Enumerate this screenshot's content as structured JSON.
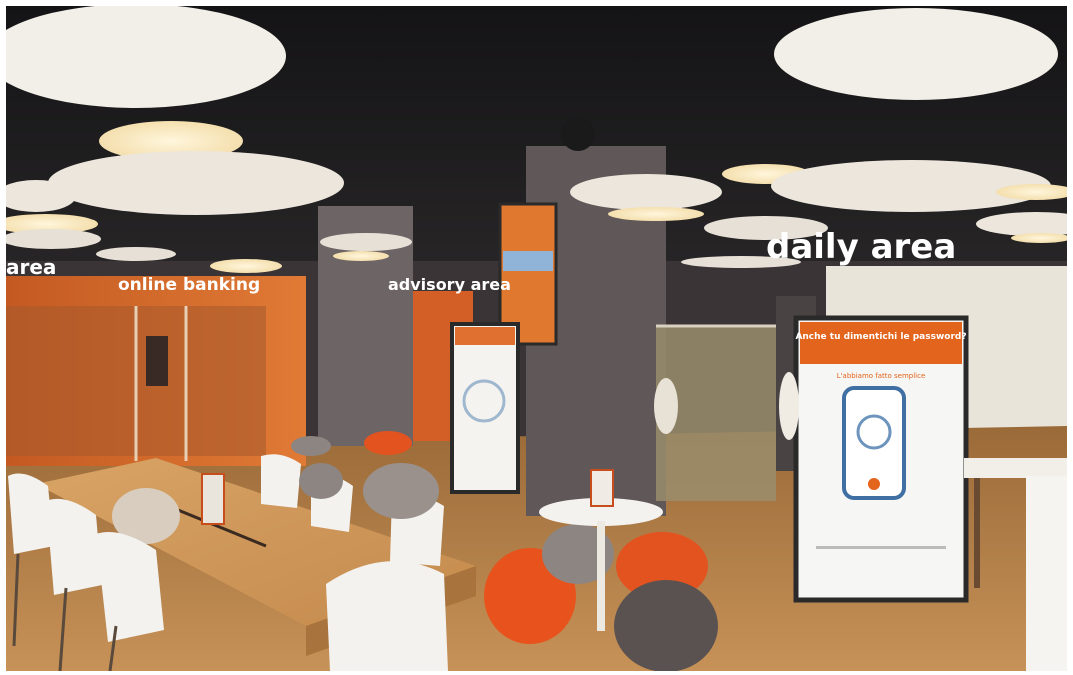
{
  "signs": {
    "area_left": "area",
    "online_banking": "online banking",
    "advisory_area": "advisory area",
    "daily_area": "daily area"
  },
  "poster": {
    "headline": "Anche tu dimentichi le password?",
    "subline": "L'abbiamo fatto semplice"
  },
  "colors": {
    "brand_orange": "#e8641e",
    "ceiling": "#1e1d1f",
    "floor": "#b7834a",
    "table": "#d19a5a"
  }
}
